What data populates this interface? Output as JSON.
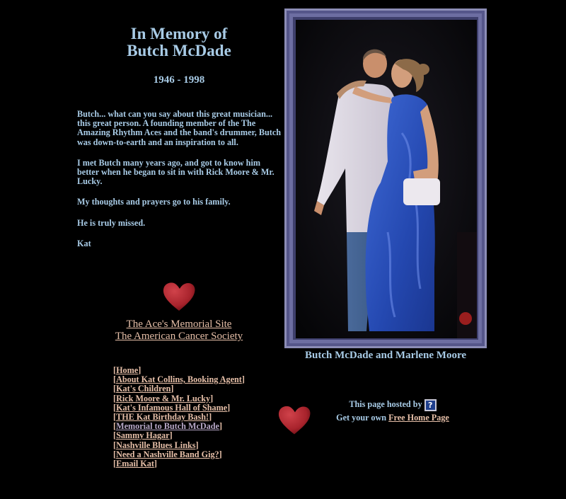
{
  "page": {
    "title_line1": "In Memory of",
    "title_line2": "Butch McDade",
    "years": "1946 - 1998"
  },
  "bio": {
    "paragraphs": [
      "Butch... what can you say about this great musician... this great person. A founding member of the The Amazing Rhythm Aces and the band's drummer, Butch was down-to-earth and an inspiration to all.",
      "I met Butch many years ago, and got to know him better when he began to sit in with Rick Moore & Mr. Lucky.",
      "My thoughts and prayers go to his family.",
      "He is truly missed.",
      "Kat"
    ]
  },
  "memorial_links": {
    "aces": "The Ace's Memorial Site",
    "cancer": "The American Cancer Society"
  },
  "photo": {
    "caption": "Butch McDade and Marlene Moore"
  },
  "nav": {
    "items": [
      "Home",
      "About Kat Collins, Booking Agent",
      "Kat's Children",
      "Rick Moore & Mr. Lucky",
      "Kat's Infamous Hall of Shame",
      "THE Kat Birthday Bash!",
      "Memorial to Butch McDade",
      "Sammy Hagar",
      "Nashville Blues Links",
      "Need a Nashville Band Gig?",
      "Email Kat"
    ]
  },
  "host": {
    "hosted_by": "This page hosted by",
    "badge_glyph": "?",
    "get_own": "Get your own",
    "free_home_page": "Free Home Page"
  },
  "colors": {
    "background": "#000000",
    "text": "#a8cbe6",
    "link": "#e6bfa8",
    "heart": "#a8232c"
  },
  "icons": {
    "heart_top": "heart-icon",
    "heart_bottom": "heart-icon",
    "host_badge": "question-icon"
  }
}
